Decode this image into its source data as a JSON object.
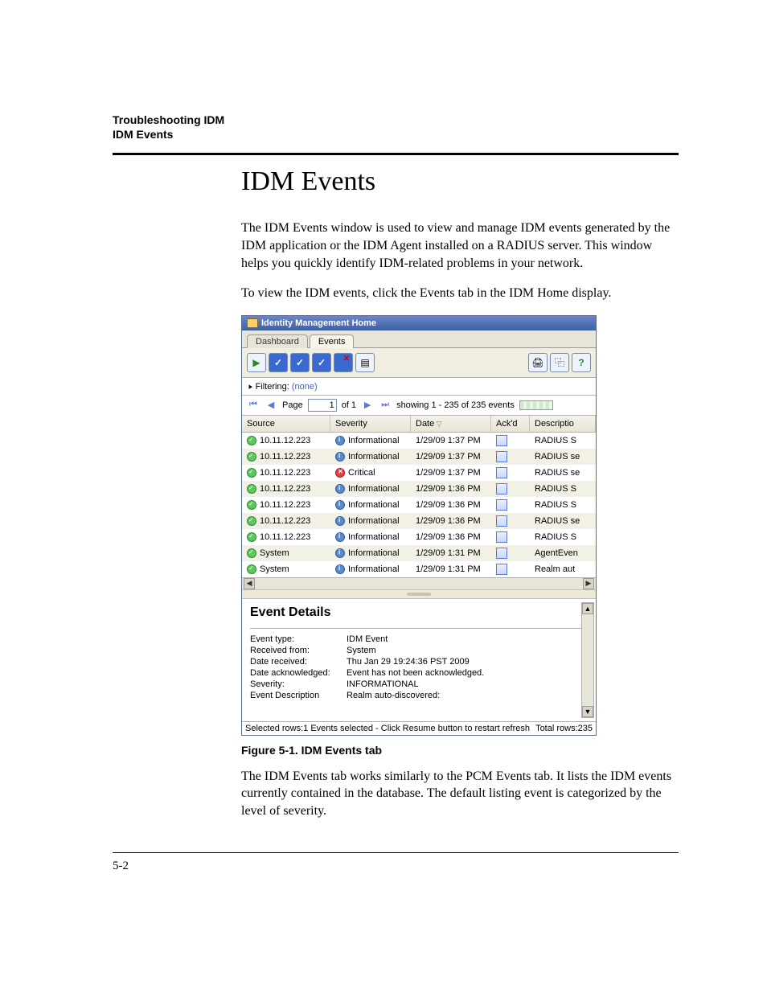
{
  "running_head": {
    "line1": "Troubleshooting IDM",
    "line2": "IDM Events"
  },
  "section_title": "IDM Events",
  "para1": "The IDM Events window is used to view and manage IDM events generated by the IDM application or the IDM Agent installed on a RADIUS server. This window helps you quickly identify IDM-related problems in your network.",
  "para2": "To view the IDM events, click the Events tab in the IDM Home display.",
  "figure_caption": "Figure 5-1. IDM Events tab",
  "para3": "The IDM Events tab works similarly to the PCM Events tab. It lists the IDM events currently contained in the database. The default listing event is categorized by the level of severity.",
  "page_number": "5-2",
  "app": {
    "title": "Identity Management Home",
    "tabs": {
      "dashboard": "Dashboard",
      "events": "Events"
    },
    "filter": {
      "label": "Filtering:",
      "value": "(none)"
    },
    "pager": {
      "page_label": "Page",
      "page_value": "1",
      "of_label": "of 1",
      "showing": "showing 1 - 235 of 235 events"
    },
    "columns": {
      "source": "Source",
      "severity": "Severity",
      "date": "Date",
      "ackd": "Ack'd",
      "description": "Descriptio"
    },
    "severity_labels": {
      "info": "Informational",
      "critical": "Critical"
    },
    "rows": [
      {
        "source": "10.11.12.223",
        "severity": "info",
        "date": "1/29/09 1:37 PM",
        "desc": "RADIUS S",
        "alt": false
      },
      {
        "source": "10.11.12.223",
        "severity": "info",
        "date": "1/29/09 1:37 PM",
        "desc": "RADIUS se",
        "alt": true
      },
      {
        "source": "10.11.12.223",
        "severity": "critical",
        "date": "1/29/09 1:37 PM",
        "desc": "RADIUS se",
        "alt": false
      },
      {
        "source": "10.11.12.223",
        "severity": "info",
        "date": "1/29/09 1:36 PM",
        "desc": "RADIUS S",
        "alt": true
      },
      {
        "source": "10.11.12.223",
        "severity": "info",
        "date": "1/29/09 1:36 PM",
        "desc": "RADIUS S",
        "alt": false
      },
      {
        "source": "10.11.12.223",
        "severity": "info",
        "date": "1/29/09 1:36 PM",
        "desc": "RADIUS se",
        "alt": true
      },
      {
        "source": "10.11.12.223",
        "severity": "info",
        "date": "1/29/09 1:36 PM",
        "desc": "RADIUS S",
        "alt": false
      },
      {
        "source": "System",
        "severity": "info",
        "date": "1/29/09 1:31 PM",
        "desc": "AgentEven",
        "alt": true
      },
      {
        "source": "System",
        "severity": "info",
        "date": "1/29/09 1:31 PM",
        "desc": "Realm aut",
        "alt": false
      }
    ],
    "details": {
      "heading": "Event Details",
      "event_type_k": "Event type:",
      "event_type_v": "IDM Event",
      "received_from_k": "Received from:",
      "received_from_v": "System",
      "date_received_k": "Date received:",
      "date_received_v": "Thu Jan 29 19:24:36 PST 2009",
      "date_ack_k": "Date acknowledged:",
      "date_ack_v": "Event has not been acknowledged.",
      "severity_k": "Severity:",
      "severity_v": "INFORMATIONAL",
      "event_desc_k": "Event Description",
      "event_desc_v": "Realm auto-discovered:"
    },
    "status": {
      "left": "Selected rows:1 Events selected - Click Resume button to restart refresh",
      "right": "Total rows:235"
    }
  }
}
